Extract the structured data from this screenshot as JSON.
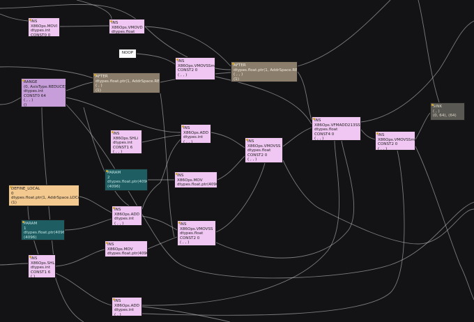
{
  "colors": {
    "background": "#131316",
    "edge": "#d2d2d2",
    "ins": "#f0c7f2",
    "range": "#c79ed9",
    "after": "#8b7d6c",
    "param": "#1e5d62",
    "define_local": "#f4c990",
    "noop": "#fbfbfb",
    "sink": "#5a5852",
    "badge": "#d4a72c"
  },
  "nodes": [
    {
      "id": "ins-movi",
      "kind": "pink",
      "lines": [
        "INS",
        "X86Ops.MOVI",
        "dtypes.int",
        "CONST0 0"
      ]
    },
    {
      "id": "ins-vmovd",
      "kind": "pink",
      "lines": [
        "INS",
        "X86Ops.VMOVD",
        "dtypes.float"
      ]
    },
    {
      "id": "noop",
      "kind": "white",
      "lines": [
        "NOOP"
      ]
    },
    {
      "id": "ins-vmovssm-top",
      "kind": "pink",
      "lines": [
        "INS",
        "X86Ops.VMOVSSm",
        "CONST2 0",
        "( , , )"
      ]
    },
    {
      "id": "after-1",
      "kind": "brown",
      "lines": [
        "AFTER",
        "dtypes.float.ptr(1, AddrSpace.REG)",
        "( , )",
        "(1)"
      ]
    },
    {
      "id": "after-2",
      "kind": "brown",
      "lines": [
        "AFTER",
        "dtypes.float.ptr(1, AddrSpace.REG)",
        "( , , )",
        "(1)"
      ]
    },
    {
      "id": "range",
      "kind": "purple",
      "lines": [
        "RANGE",
        "(0, AxisType.REDUCE)",
        "dtypes.int",
        "CONST0 64",
        "( , , )",
        "()"
      ]
    },
    {
      "id": "ins-shli-1",
      "kind": "pink",
      "lines": [
        "INS",
        "X86Ops.SHLi",
        "dtypes.int",
        "CONST1 6",
        "( , , )"
      ]
    },
    {
      "id": "ins-add-1",
      "kind": "pink",
      "lines": [
        "INS",
        "X86Ops.ADD",
        "dtypes.int",
        "( , , )"
      ]
    },
    {
      "id": "ins-vmovss",
      "kind": "pink",
      "lines": [
        "INS",
        "X86Ops.VMOVSS",
        "dtypes.float",
        "CONST2 0",
        "( , , )"
      ]
    },
    {
      "id": "ins-vfmadd",
      "kind": "pink",
      "lines": [
        "INS",
        "X86Ops.VFMADD213SS",
        "dtypes.float",
        "CONST4 0",
        "( , , )"
      ]
    },
    {
      "id": "ins-vmovssm-right",
      "kind": "pink",
      "lines": [
        "INS",
        "X86Ops.VMOVSSm",
        "CONST2 0",
        "( , , )"
      ]
    },
    {
      "id": "sink",
      "kind": "gray",
      "lines": [
        "SINK",
        "( , )",
        "(0, 64), (64)"
      ]
    },
    {
      "id": "param-2",
      "kind": "teal",
      "lines": [
        "PARAM",
        "2",
        "dtypes.float.ptr(4096)",
        "(4096)"
      ]
    },
    {
      "id": "ins-mov-1",
      "kind": "pink",
      "lines": [
        "INS",
        "X86Ops.MOV",
        "dtypes.float.ptr(4096)"
      ]
    },
    {
      "id": "define-local",
      "kind": "orange",
      "lines": [
        "DEFINE_LOCAL",
        "0",
        "dtypes.float.ptr(1, AddrSpace.LOCAL)",
        "(1)"
      ]
    },
    {
      "id": "ins-add-2",
      "kind": "pink",
      "lines": [
        "INS",
        "X86Ops.ADD",
        "dtypes.int",
        "( , , )"
      ]
    },
    {
      "id": "param-1",
      "kind": "teal",
      "lines": [
        "PARAM",
        "1",
        "dtypes.float.ptr(4096)",
        "(4096)"
      ]
    },
    {
      "id": "ins-vmovss-2",
      "kind": "pink",
      "lines": [
        "INS",
        "X86Ops.VMOVSS",
        "dtypes.float",
        "CONST2 0",
        "( , , )"
      ]
    },
    {
      "id": "ins-mov-2",
      "kind": "pink",
      "lines": [
        "INS",
        "X86Ops.MOV",
        "dtypes.float.ptr(4096)"
      ]
    },
    {
      "id": "ins-shli-2",
      "kind": "pink",
      "lines": [
        "INS",
        "X86Ops.SHLi",
        "dtypes.int",
        "CONST1 6",
        "( )"
      ]
    },
    {
      "id": "ins-add-3",
      "kind": "pink",
      "lines": [
        "INS",
        "X86Ops.ADD",
        "dtypes.int",
        "( , )"
      ]
    }
  ]
}
